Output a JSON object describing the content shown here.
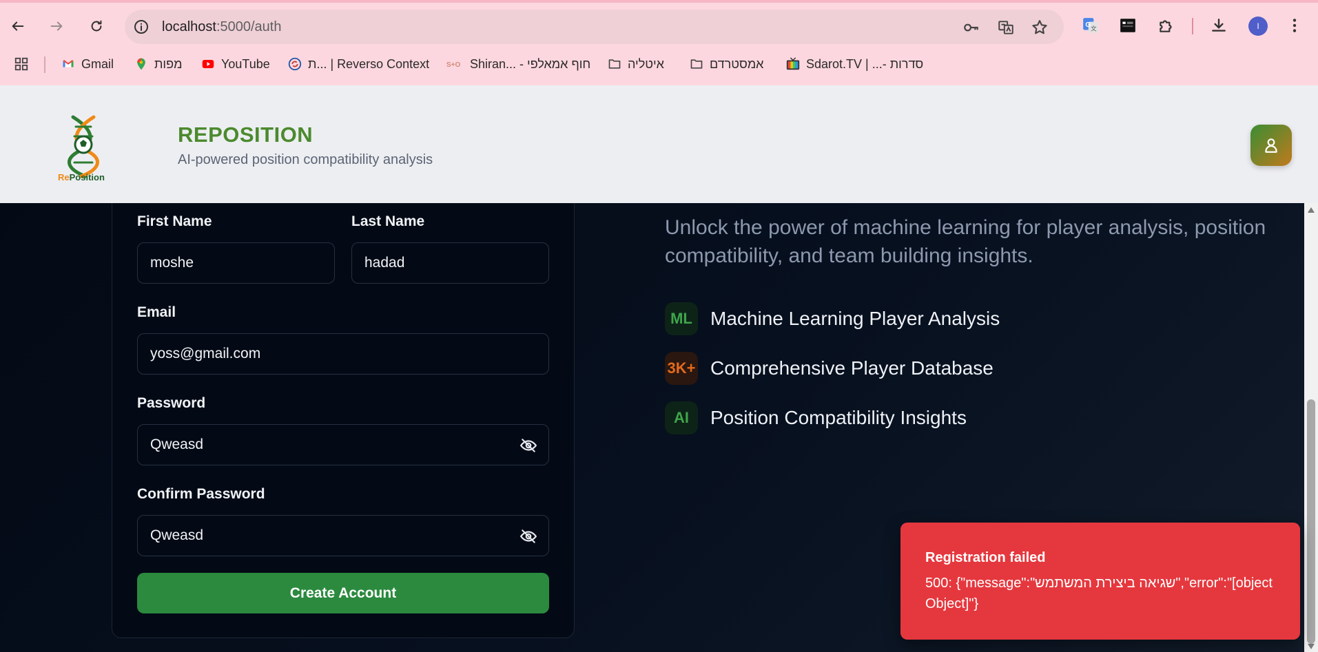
{
  "browser": {
    "url_host": "localhost",
    "url_path": ":5000/auth",
    "profile_initial": "I",
    "bookmarks": [
      {
        "label": "Gmail",
        "icon": "gmail-icon"
      },
      {
        "label": "מפות",
        "icon": "maps-icon"
      },
      {
        "label": "YouTube",
        "icon": "youtube-icon"
      },
      {
        "label": "ת... | Reverso Context",
        "icon": "reverso-icon"
      },
      {
        "label": "Shiran... - חוף אמאלפי",
        "icon": "shiran-icon"
      },
      {
        "label": "איטליה",
        "icon": "folder-icon"
      },
      {
        "label": "אמסטרדם",
        "icon": "folder-icon"
      },
      {
        "label": "Sdarot.TV | ...- סדרות",
        "icon": "sdarot-icon"
      }
    ]
  },
  "header": {
    "logo_text_re": "Re",
    "logo_text_position": "Position",
    "title": "REPOSITION",
    "subtitle": "AI-powered position compatibility analysis"
  },
  "form": {
    "first_name_label": "First Name",
    "first_name_value": "moshe",
    "last_name_label": "Last Name",
    "last_name_value": "hadad",
    "email_label": "Email",
    "email_value": "yoss@gmail.com",
    "password_label": "Password",
    "password_value": "Qweasd",
    "confirm_label": "Confirm Password",
    "confirm_value": "Qweasd",
    "submit_label": "Create Account"
  },
  "hero": {
    "description": "Unlock the power of machine learning for player analysis, position compatibility, and team building insights.",
    "features": [
      {
        "badge": "ML",
        "label": "Machine Learning Player Analysis",
        "color": "#3fa54a"
      },
      {
        "badge": "3K+",
        "label": "Comprehensive Player Database",
        "color": "#e36a1b"
      },
      {
        "badge": "AI",
        "label": "Position Compatibility Insights",
        "color": "#3fa54a"
      }
    ]
  },
  "toast": {
    "title": "Registration failed",
    "message": "500: {\"message\":\"שגיאה ביצירת המשתמש\",\"error\":\"[object Object]\"}"
  },
  "colors": {
    "accent_green": "#4b8a2e",
    "button_green": "#2b8a3e",
    "toast_red": "#e5383e",
    "background": "#050b16"
  }
}
